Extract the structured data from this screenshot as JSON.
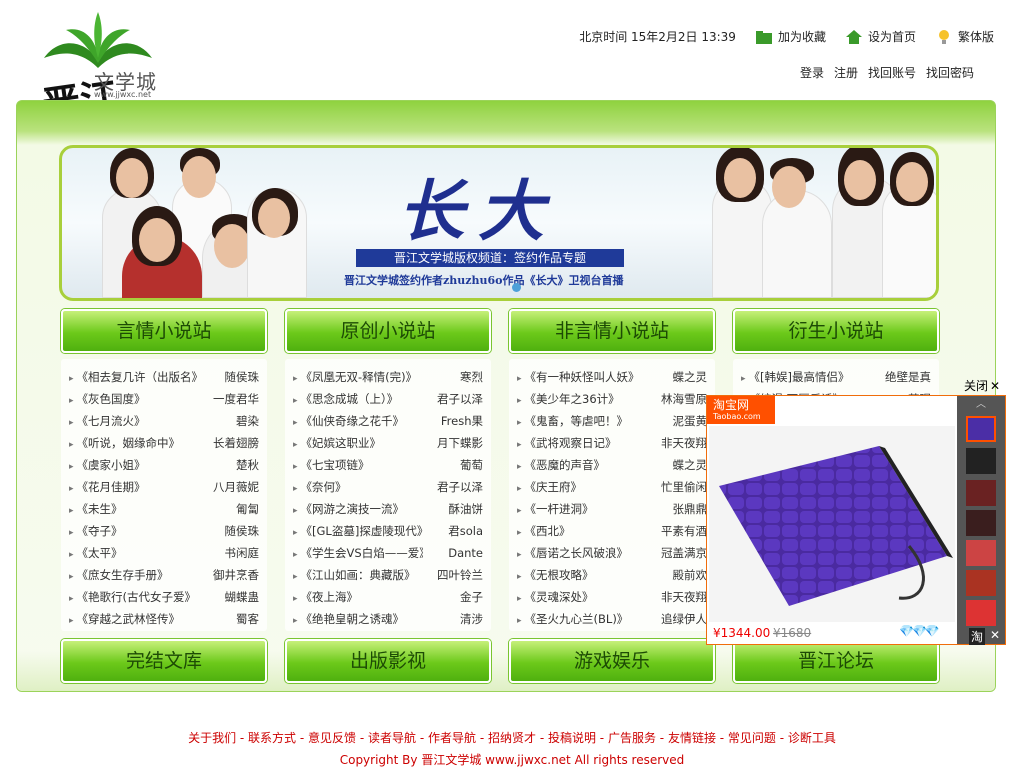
{
  "header": {
    "logo_text": "文学城",
    "logo_url": "www.jjwxc.net",
    "logo_calligraphy": "晋江",
    "beijing_time": "北京时间 15年2月2日 13:39",
    "favorite": "加为收藏",
    "homepage": "设为首页",
    "traditional": "繁体版",
    "accounts": [
      "登录",
      "注册",
      "找回账号",
      "找回密码"
    ]
  },
  "banner": {
    "title": "长大",
    "subtitle": "晋江文学城版权频道：签约作品专题",
    "caption": "晋江文学城签约作者zhuzhu6o作品《长大》卫视台首播"
  },
  "columns": [
    {
      "title": "言情小说站",
      "items": [
        {
          "t": "《相去复几许（出版名》",
          "a": "随侯珠"
        },
        {
          "t": "《灰色国度》",
          "a": "一度君华"
        },
        {
          "t": "《七月流火》",
          "a": "碧染"
        },
        {
          "t": "《听说，姻缘命中》",
          "a": "长着翅膀"
        },
        {
          "t": "《虞家小姐》",
          "a": "楚秋"
        },
        {
          "t": "《花月佳期》",
          "a": "八月薇妮"
        },
        {
          "t": "《未生》",
          "a": "匍匐"
        },
        {
          "t": "《夺子》",
          "a": "随侯珠"
        },
        {
          "t": "《太平》",
          "a": "书闲庭"
        },
        {
          "t": "《庶女生存手册》",
          "a": "御井烹香"
        },
        {
          "t": "《艳歌行(古代女子爱》",
          "a": "蝴蝶蛊"
        },
        {
          "t": "《穿越之武林怪传》",
          "a": "蜀客"
        }
      ],
      "footer": "完结文库"
    },
    {
      "title": "原创小说站",
      "items": [
        {
          "t": "《凤凰无双-释情(完)》",
          "a": "寒烈"
        },
        {
          "t": "《思念成城（上）》",
          "a": "君子以泽"
        },
        {
          "t": "《仙侠奇缘之花千》",
          "a": "Fresh果"
        },
        {
          "t": "《妃嫔这职业》",
          "a": "月下蝶影"
        },
        {
          "t": "《七宝项链》",
          "a": "葡萄"
        },
        {
          "t": "《奈何》",
          "a": "君子以泽"
        },
        {
          "t": "《网游之演技一流》",
          "a": "酥油饼"
        },
        {
          "t": "《[GL盗墓]探虚陵现代》",
          "a": "君sola"
        },
        {
          "t": "《学生会VS白焰——爱》",
          "a": "Dante"
        },
        {
          "t": "《江山如画：典藏版》",
          "a": "四叶铃兰"
        },
        {
          "t": "《夜上海》",
          "a": "金子"
        },
        {
          "t": "《绝艳皇朝之诱魂》",
          "a": "清涉"
        }
      ],
      "footer": "出版影视"
    },
    {
      "title": "非言情小说站",
      "items": [
        {
          "t": "《有一种妖怪叫人妖》",
          "a": "蝶之灵"
        },
        {
          "t": "《美少年之36计》",
          "a": "林海雪原"
        },
        {
          "t": "《鬼畜，等虐吧！》",
          "a": "泥蛋黄"
        },
        {
          "t": "《武将观察日记》",
          "a": "非天夜翔"
        },
        {
          "t": "《恶魔的声音》",
          "a": "蝶之灵"
        },
        {
          "t": "《庆王府》",
          "a": "忙里偷闲"
        },
        {
          "t": "《一杆进洞》",
          "a": "张鼎鼎"
        },
        {
          "t": "《西北》",
          "a": "平素有酒"
        },
        {
          "t": "《唇诺之长风破浪》",
          "a": "冠盖满京"
        },
        {
          "t": "《无根攻略》",
          "a": "殿前欢"
        },
        {
          "t": "《灵魂深处》",
          "a": "非天夜翔"
        },
        {
          "t": "《圣火九心兰(BL)》",
          "a": "追绿伊人"
        }
      ],
      "footer": "游戏娱乐"
    },
    {
      "title": "衍生小说站",
      "items": [
        {
          "t": "《[韩娱]最高情侣》",
          "a": "绝壁是真"
        },
        {
          "t": "《综漫 下厨乐诱》",
          "a": "若眠"
        }
      ],
      "footer": "晋江论坛"
    }
  ],
  "footer": {
    "links": [
      "关于我们",
      "联系方式",
      "意见反馈",
      "读者导航",
      "作者导航",
      "招纳贤才",
      "投稿说明",
      "广告服务",
      "友情链接",
      "常见问题",
      "诊断工具"
    ],
    "copyright": "Copyright By 晋江文学城 www.jjwxc.net All rights reserved"
  },
  "ad": {
    "close_label": "关闭",
    "close_x": "✕",
    "logo": "淘宝网",
    "logo_sub": "Taobao.com",
    "price": "¥1344.00",
    "old_price": "¥1680",
    "gems": "💎💎💎",
    "tao": "淘",
    "x": "✕"
  },
  "colors": {
    "green_accent": "#6cc91a",
    "footer_red": "#cc0000",
    "taobao_orange": "#ff5000"
  }
}
